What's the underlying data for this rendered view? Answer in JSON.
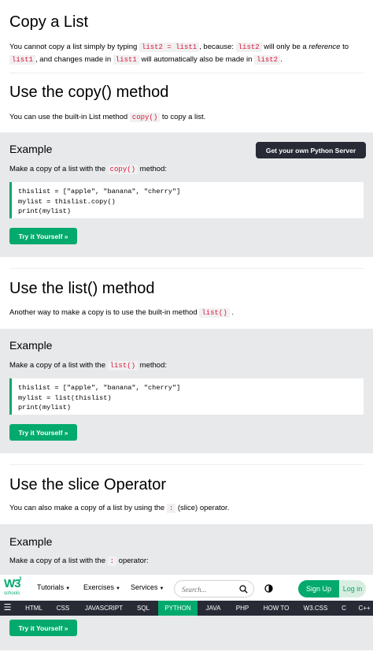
{
  "sections": {
    "copy_list": {
      "title": "Copy a List",
      "p_1": "You cannot copy a list simply by typing",
      "code_1": "list2 = list1",
      "p_2": ", because:",
      "code_2": "list2",
      "p_3": "will only be a",
      "p_em": "reference",
      "p_4": "to",
      "code_3": "list1",
      "p_5": ", and changes made in",
      "code_4": "list1",
      "p_6": "will automatically also be made in",
      "code_5": "list2",
      "p_7": "."
    },
    "copy_method": {
      "title": "Use the copy() method",
      "p_1": "You can use the built-in List method",
      "code_1": "copy()",
      "p_2": "to copy a list."
    },
    "list_method": {
      "title": "Use the list() method",
      "p_1": "Another way to make a copy is to use the built-in method",
      "code_1": "list()",
      "p_2": "."
    },
    "slice": {
      "title": "Use the slice Operator",
      "p_1": "You can also make a copy of a list by using the",
      "code_1": ":",
      "p_2": "(slice) operator."
    }
  },
  "examples": [
    {
      "title": "Example",
      "server_button": "Get your own Python Server",
      "desc_1": "Make a copy of a list with the",
      "desc_code": "copy()",
      "desc_2": "method:",
      "code": [
        "thislist = [\"apple\", \"banana\", \"cherry\"]",
        "mylist = thislist.copy()",
        "print(mylist)"
      ],
      "button": "Try it Yourself »"
    },
    {
      "title": "Example",
      "desc_1": "Make a copy of a list with the",
      "desc_code": "list()",
      "desc_2": "method:",
      "code": [
        "thislist = [\"apple\", \"banana\", \"cherry\"]",
        "mylist = list(thislist)",
        "print(mylist)"
      ],
      "button": "Try it Yourself »"
    },
    {
      "title": "Example",
      "desc_1": "Make a copy of a list with the",
      "desc_code": ":",
      "desc_2": "operator:",
      "button": "Try it Yourself »"
    }
  ],
  "navbar": {
    "logo_text": "W3",
    "logo_sup": "3",
    "logo_sub": "schools",
    "tutorials": "Tutorials",
    "exercises": "Exercises",
    "services": "Services",
    "search_placeholder": "Search...",
    "signup": "Sign Up",
    "login": "Log in"
  },
  "topnav": {
    "items": [
      "HTML",
      "CSS",
      "JAVASCRIPT",
      "SQL",
      "PYTHON",
      "JAVA",
      "PHP",
      "HOW TO",
      "W3.CSS",
      "C",
      "C++"
    ],
    "active": "PYTHON"
  },
  "colors": {
    "accent": "#04aa6d",
    "dark": "#282a35",
    "example_bg": "#e7e9eb",
    "code_red": "#dc143c"
  }
}
